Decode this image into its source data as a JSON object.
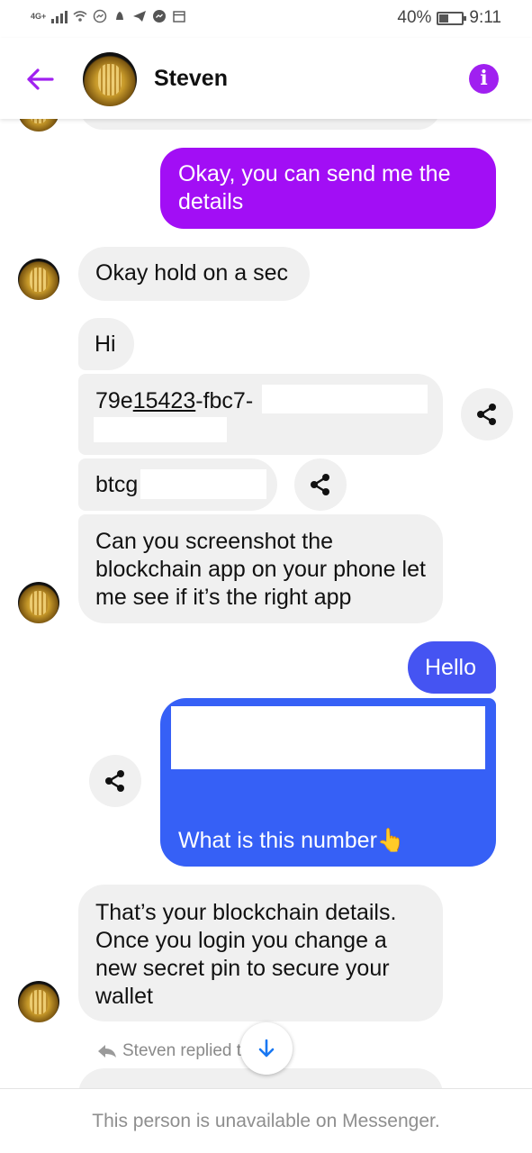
{
  "status_bar": {
    "network": "4G+",
    "battery_text": "40%",
    "battery_level": 0.4,
    "time": "9:11"
  },
  "header": {
    "contact_name": "Steven",
    "back_icon": "arrow-left-icon",
    "info_icon": "info-icon",
    "accent_color": "#a020f0"
  },
  "messages": {
    "sent_send_details": "Okay, you can send me the details",
    "recv_hold_on": "Okay hold on a sec",
    "recv_hi": "Hi",
    "recv_code_prefix": "79e",
    "recv_code_underlined": "15423",
    "recv_code_suffix": "-fbc7-",
    "recv_btcg": "btcg",
    "recv_screenshot_request": "Can you screenshot the blockchain app on your phone let me see if it’s the right app",
    "sent_hello": "Hello",
    "sent_what_number": "What is this number👆",
    "recv_blockchain_details": "That’s your blockchain details. Once you login you change a new secret pin to secure your wallet"
  },
  "reply_indicator": "Steven replied t",
  "footer": {
    "unavailable_text": "This person is unavailable on Messenger."
  },
  "colors": {
    "purple_bubble": "#a20ef5",
    "blue_bubble": "#3d5bf5",
    "incoming_bubble": "#f0f0f0"
  }
}
